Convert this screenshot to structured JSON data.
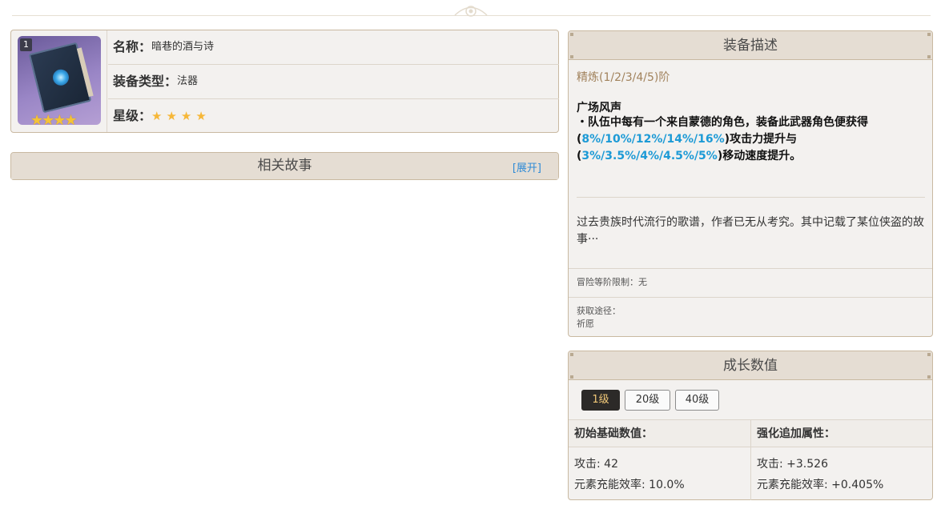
{
  "weapon": {
    "refinement_badge": "1",
    "name_label": "名称：",
    "name_value": "暗巷的酒与诗",
    "type_label": "装备类型：",
    "type_value": "法器",
    "rarity_label": "星级：",
    "rarity_stars": 4,
    "icon": "weapon-book-icon"
  },
  "story": {
    "title": "相关故事",
    "expand_label": "[展开]"
  },
  "description": {
    "title": "装备描述",
    "refinement": "精炼(1/2/3/4/5)阶",
    "skill_name": "广场风声",
    "skill_prefix": "・队伍中每有一个来自蒙德的角色，装备此武器角色便获得(",
    "skill_values_1": "8%/10%/12%/14%/16%",
    "skill_middle": ")攻击力提升与(",
    "skill_values_2": "3%/3.5%/4%/4.5%/5%",
    "skill_suffix": ")移动速度提升。",
    "flavor": "过去贵族时代流行的歌谱，作者已无从考究。其中记载了某位侠盗的故事···",
    "level_limit": "冒险等阶限制：无",
    "source_label": "获取途径：",
    "source_value": "祈愿"
  },
  "growth": {
    "title": "成长数值",
    "levels": [
      "1级",
      "20级",
      "40级"
    ],
    "active_level": "1级",
    "base_header": "初始基础数值：",
    "bonus_header": "强化追加属性：",
    "base_stats": [
      "攻击: 42",
      "元素充能效率: 10.0%"
    ],
    "bonus_stats": [
      "攻击: +3.526",
      "元素充能效率: +0.405%"
    ]
  },
  "colors": {
    "accent_blue": "#1c9ad6",
    "refine_brown": "#a1825c",
    "star_gold": "#f6b738",
    "panel_header": "#e5ddd3",
    "active_button": "#2c2a28"
  }
}
